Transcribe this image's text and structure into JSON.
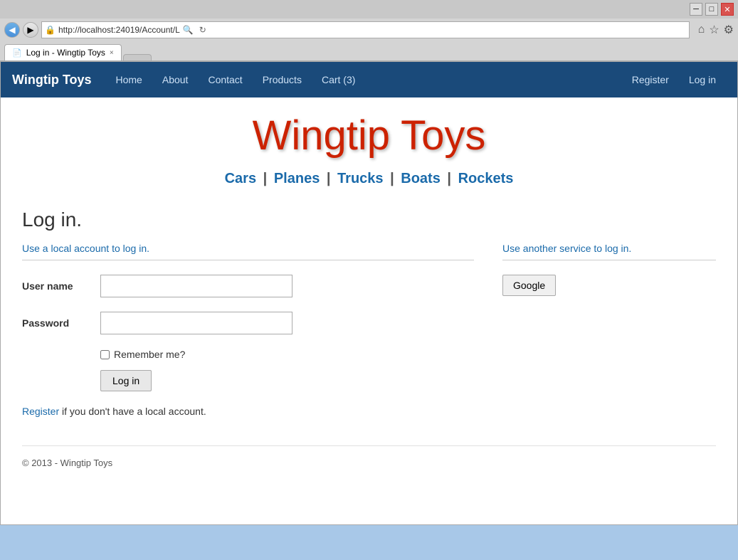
{
  "browser": {
    "url": "http://localhost:24019/Account/L",
    "tab_title": "Log in - Wingtip Toys",
    "tab_close": "×",
    "back_icon": "◀",
    "forward_icon": "▶",
    "refresh_icon": "↻",
    "home_icon": "⌂",
    "star_icon": "☆",
    "gear_icon": "⚙"
  },
  "navbar": {
    "brand": "Wingtip Toys",
    "links": [
      {
        "label": "Home",
        "name": "home"
      },
      {
        "label": "About",
        "name": "about"
      },
      {
        "label": "Contact",
        "name": "contact"
      },
      {
        "label": "Products",
        "name": "products"
      },
      {
        "label": "Cart (3)",
        "name": "cart"
      }
    ],
    "right_links": [
      {
        "label": "Register",
        "name": "register"
      },
      {
        "label": "Log in",
        "name": "login"
      }
    ]
  },
  "site_title": "Wingtip Toys",
  "categories": [
    {
      "label": "Cars",
      "name": "cars"
    },
    {
      "label": "Planes",
      "name": "planes"
    },
    {
      "label": "Trucks",
      "name": "trucks"
    },
    {
      "label": "Boats",
      "name": "boats"
    },
    {
      "label": "Rockets",
      "name": "rockets"
    }
  ],
  "page": {
    "heading": "Log in.",
    "local_subtitle": "Use a local account to log in.",
    "external_subtitle": "Use another service to log in.",
    "username_label": "User name",
    "password_label": "Password",
    "remember_label": "Remember me?",
    "login_button": "Log in",
    "register_text": " if you don't have a local account.",
    "register_link": "Register",
    "google_button": "Google"
  },
  "footer": {
    "text": "© 2013 - Wingtip Toys"
  }
}
